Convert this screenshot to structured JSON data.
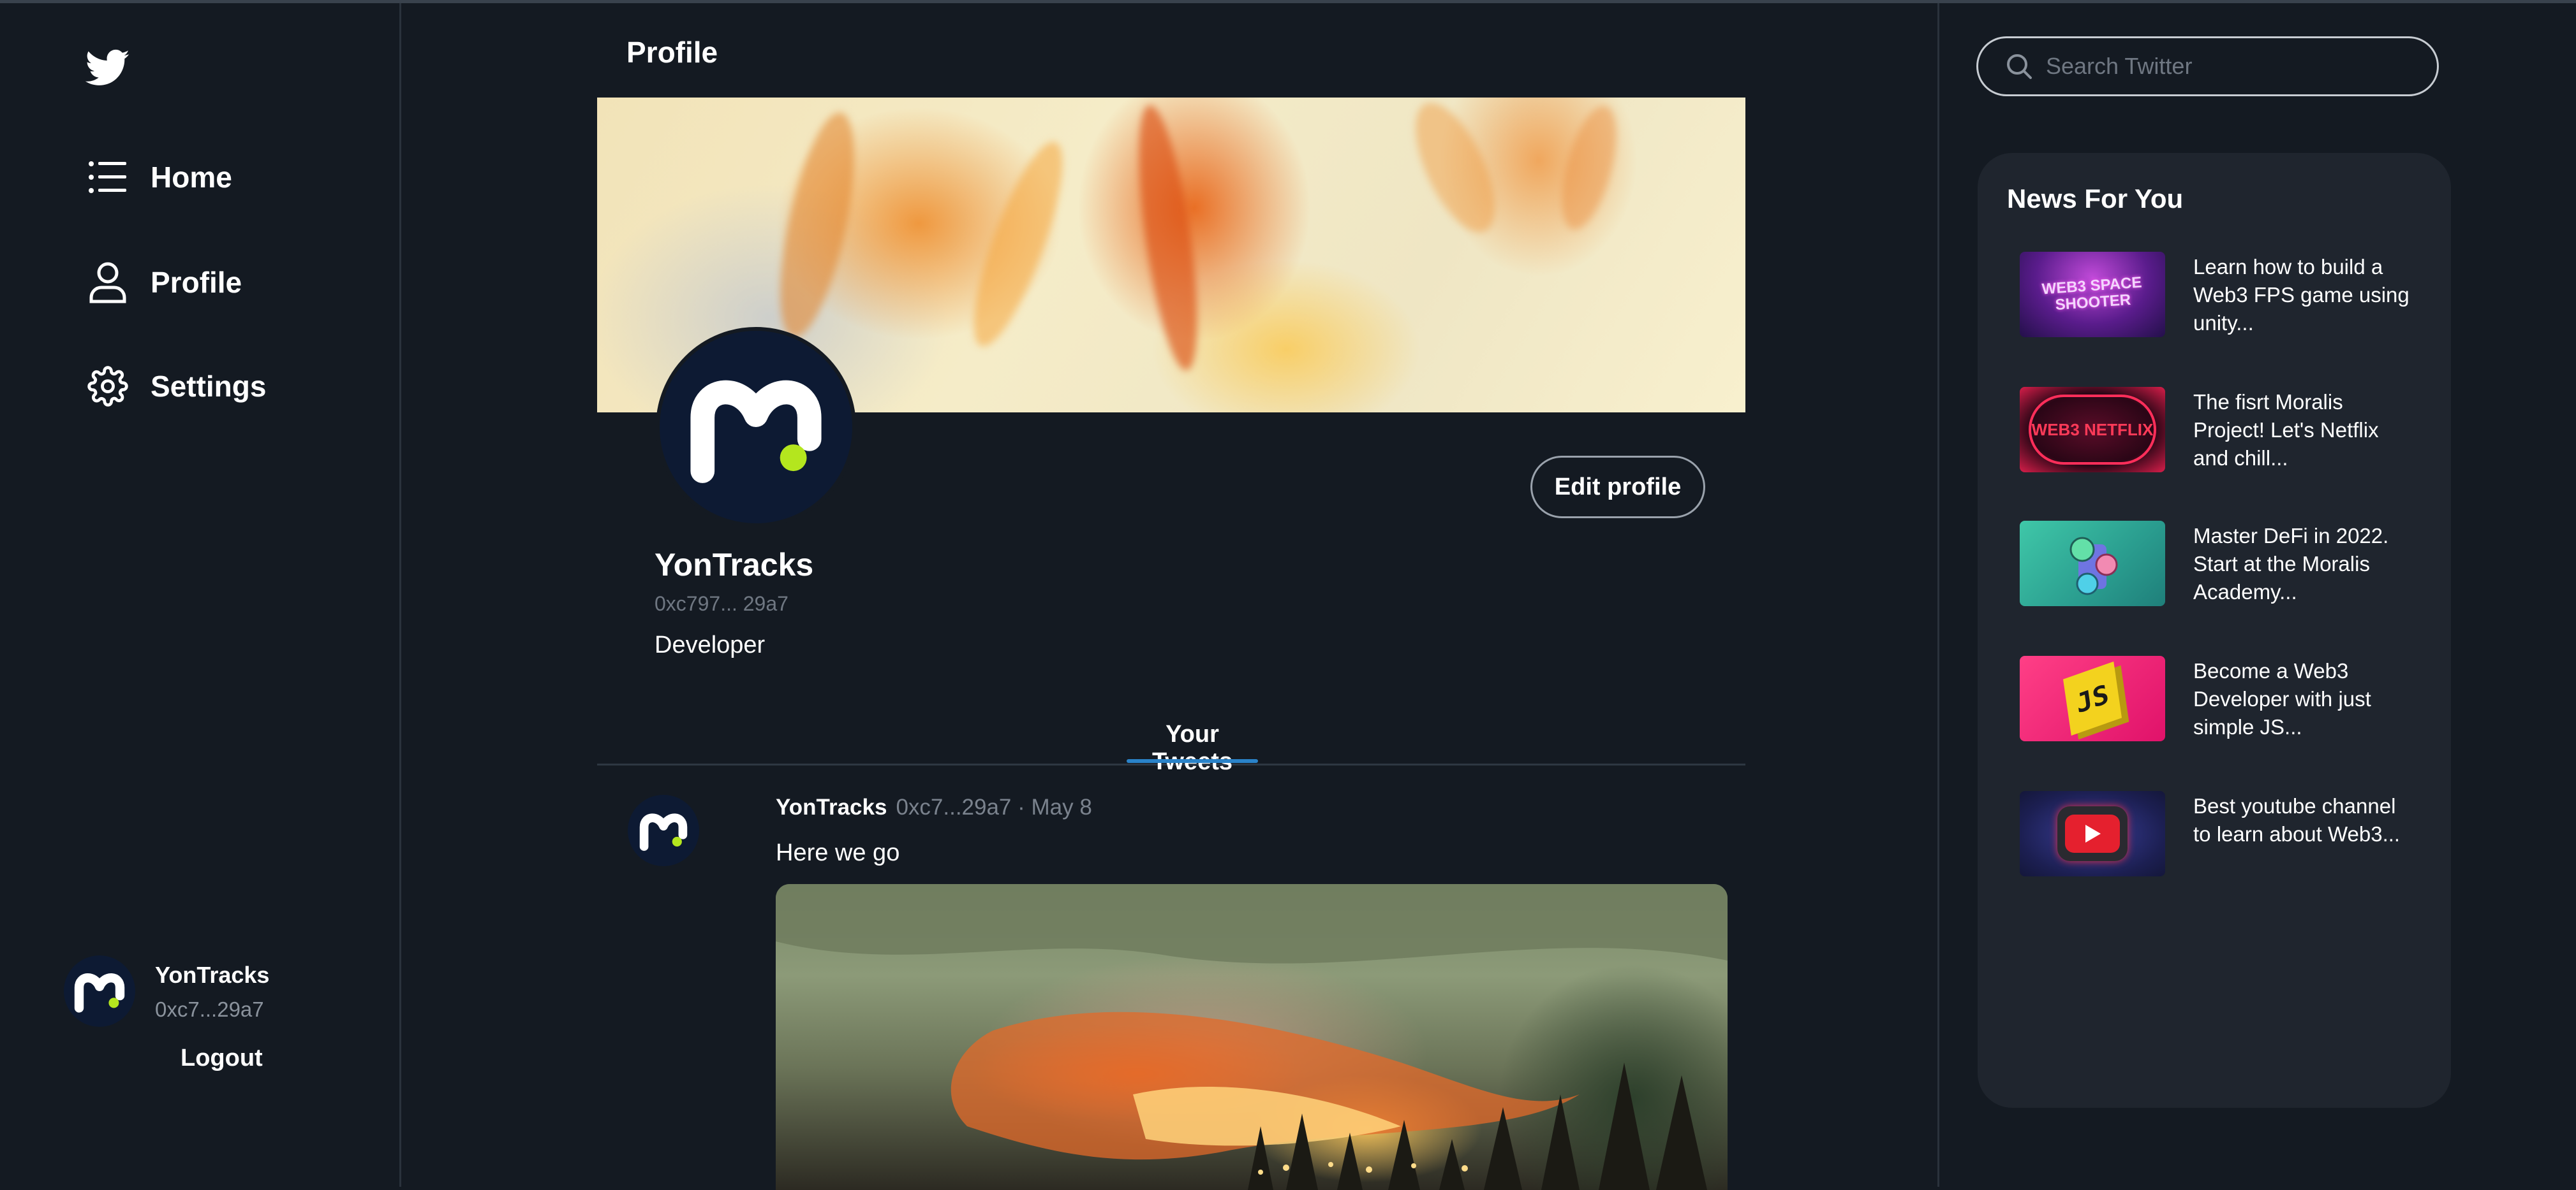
{
  "sidebar": {
    "nav": [
      {
        "label": "Home",
        "icon": "list-icon"
      },
      {
        "label": "Profile",
        "icon": "user-icon"
      },
      {
        "label": "Settings",
        "icon": "gear-icon"
      }
    ],
    "user": {
      "name": "YonTracks",
      "address": "0xc7...29a7",
      "logout_label": "Logout"
    }
  },
  "main": {
    "title": "Profile",
    "profile": {
      "name": "YonTracks",
      "address": "0xc797... 29a7",
      "bio": "Developer",
      "edit_label": "Edit profile"
    },
    "tabs": [
      {
        "label": "Your Tweets",
        "active": true
      }
    ],
    "tweets": [
      {
        "name": "YonTracks",
        "meta": "0xc7...29a7 · May 8",
        "text": "Here we go"
      }
    ]
  },
  "right": {
    "search": {
      "placeholder": "Search Twitter",
      "value": ""
    },
    "news": {
      "title": "News For You",
      "items": [
        {
          "text": "Learn how to build a Web3 FPS game using unity...",
          "thumb_label": "WEB3 SPACE SHOOTER"
        },
        {
          "text": "The fisrt Moralis Project! Let's Netflix and chill...",
          "thumb_label": "WEB3 NETFLIX"
        },
        {
          "text": "Master DeFi in 2022. Start at the Moralis Academy...",
          "thumb_label": ""
        },
        {
          "text": "Become a Web3 Developer with just simple JS...",
          "thumb_label": "JS"
        },
        {
          "text": "Best youtube channel to learn about Web3...",
          "thumb_label": ""
        }
      ]
    }
  },
  "colors": {
    "background": "#141a22",
    "card": "#1f252e",
    "accent": "#2a83c9",
    "muted": "#6f7782"
  }
}
